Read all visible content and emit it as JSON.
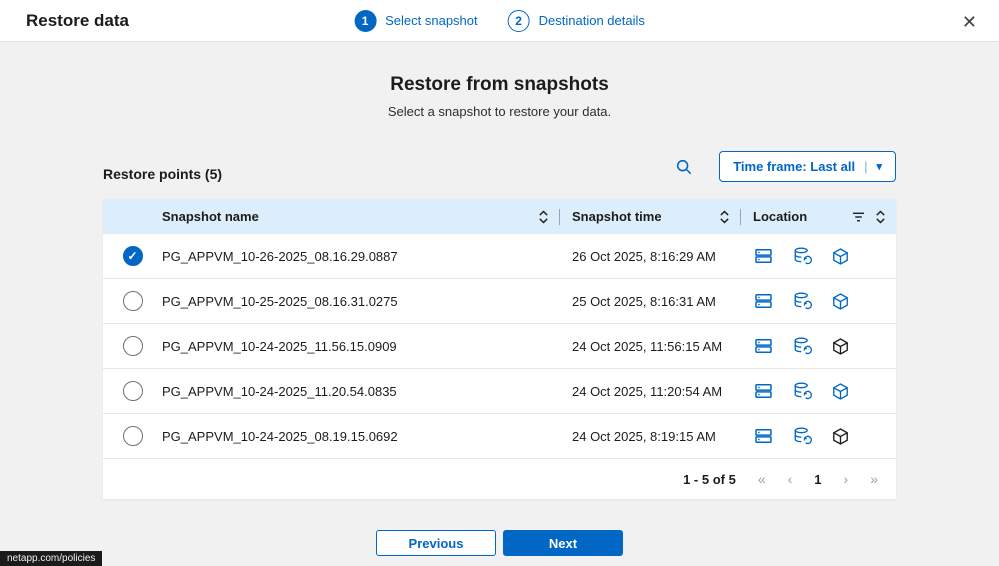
{
  "header": {
    "title": "Restore data",
    "steps": [
      {
        "number": "1",
        "label": "Select snapshot",
        "state": "active"
      },
      {
        "number": "2",
        "label": "Destination details",
        "state": "upcoming"
      }
    ],
    "close_icon": "✕"
  },
  "main": {
    "heading": "Restore from snapshots",
    "subheading": "Select a snapshot to restore your data.",
    "restore_points_label": "Restore points (5)",
    "search_icon": "search-icon",
    "timeframe_button": {
      "label": "Time frame: Last all",
      "separator": "|",
      "caret": "▾"
    },
    "table": {
      "columns": [
        "Snapshot name",
        "Snapshot time",
        "Location"
      ],
      "location_icons": [
        "storage-icon",
        "database-sync-icon",
        "package-icon"
      ],
      "rows": [
        {
          "name": "PG_APPVM_10-26-2025_08.16.29.0887",
          "time": "26 Oct 2025, 8:16:29 AM",
          "checked": true,
          "package_variant": "blue"
        },
        {
          "name": "PG_APPVM_10-25-2025_08.16.31.0275",
          "time": "25 Oct 2025, 8:16:31 AM",
          "checked": false,
          "package_variant": "blue"
        },
        {
          "name": "PG_APPVM_10-24-2025_11.56.15.0909",
          "time": "24 Oct 2025, 11:56:15 AM",
          "checked": false,
          "package_variant": "dark"
        },
        {
          "name": "PG_APPVM_10-24-2025_11.20.54.0835",
          "time": "24 Oct 2025, 11:20:54 AM",
          "checked": false,
          "package_variant": "blue"
        },
        {
          "name": "PG_APPVM_10-24-2025_08.19.15.0692",
          "time": "24 Oct 2025, 8:19:15 AM",
          "checked": false,
          "package_variant": "dark"
        }
      ]
    },
    "pagination": {
      "range": "1 - 5 of 5",
      "page": "1",
      "icons": {
        "first": "«",
        "prev": "‹",
        "next": "›",
        "last": "»"
      }
    }
  },
  "footer": {
    "previous": "Previous",
    "next": "Next"
  },
  "status_bar": {
    "link": "netapp.com/policies"
  },
  "colors": {
    "accent": "#0067C5",
    "table_header_bg": "#DCEEFB",
    "package_dark": "#1C1C1C"
  }
}
